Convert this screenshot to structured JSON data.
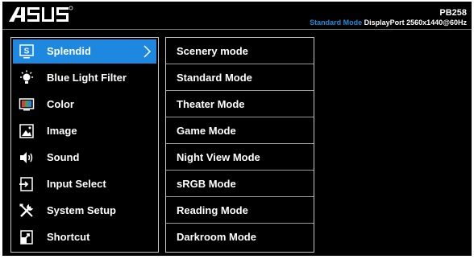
{
  "header": {
    "logo_text": "/ISUS",
    "model": "PB258",
    "status": {
      "mode": "Standard Mode",
      "input": "DisplayPort",
      "resolution": "2560x1440@60Hz"
    }
  },
  "colors": {
    "accent": "#1e88e0",
    "background": "#000000",
    "text": "#ffffff",
    "border": "#c8c8c8"
  },
  "main_menu": [
    {
      "label": "Splendid",
      "icon": "splendid-icon",
      "selected": true
    },
    {
      "label": "Blue Light Filter",
      "icon": "blue-light-filter-icon"
    },
    {
      "label": "Color",
      "icon": "color-icon"
    },
    {
      "label": "Image",
      "icon": "image-icon"
    },
    {
      "label": "Sound",
      "icon": "sound-icon"
    },
    {
      "label": "Input Select",
      "icon": "input-select-icon"
    },
    {
      "label": "System Setup",
      "icon": "system-setup-icon"
    },
    {
      "label": "Shortcut",
      "icon": "shortcut-icon"
    }
  ],
  "splendid_submenu": [
    {
      "label": "Scenery mode"
    },
    {
      "label": "Standard Mode"
    },
    {
      "label": "Theater Mode"
    },
    {
      "label": "Game Mode"
    },
    {
      "label": "Night View Mode"
    },
    {
      "label": "sRGB Mode"
    },
    {
      "label": "Reading Mode"
    },
    {
      "label": "Darkroom Mode"
    }
  ]
}
